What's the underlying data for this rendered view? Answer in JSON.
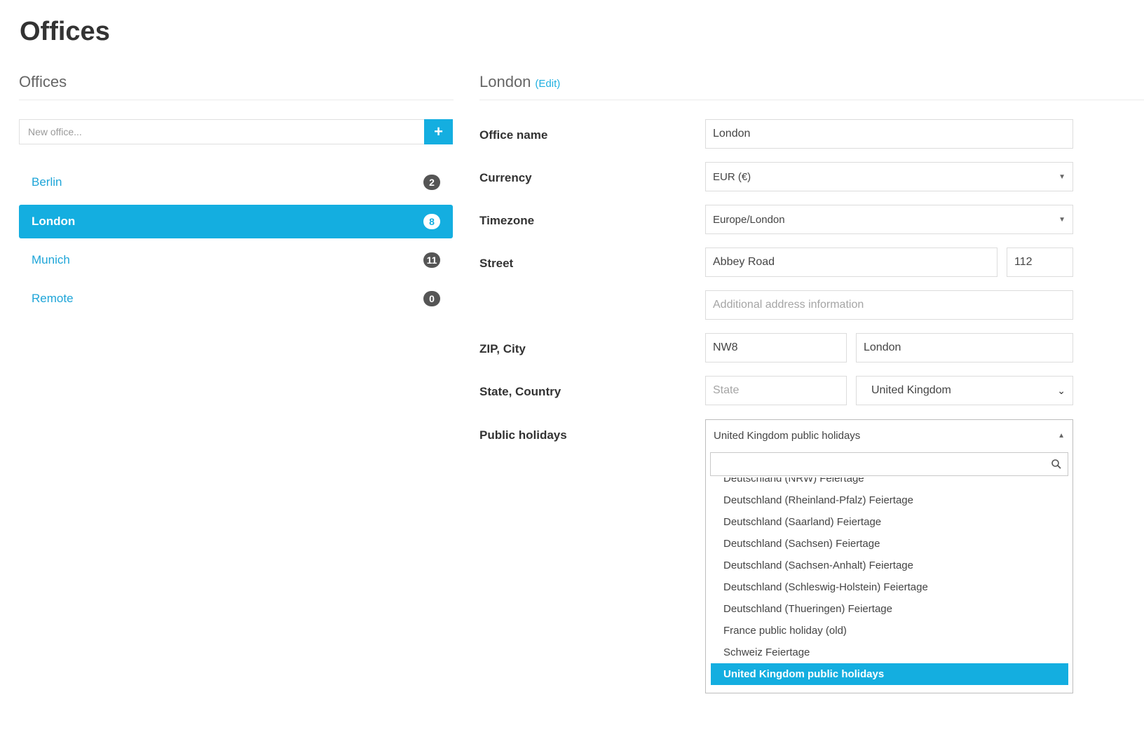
{
  "page": {
    "title": "Offices"
  },
  "left": {
    "section_title": "Offices",
    "new_office_placeholder": "New office...",
    "add_label": "+",
    "offices": [
      {
        "name": "Berlin",
        "count": "2"
      },
      {
        "name": "London",
        "count": "8"
      },
      {
        "name": "Munich",
        "count": "11"
      },
      {
        "name": "Remote",
        "count": "0"
      }
    ]
  },
  "right": {
    "section_title": "London",
    "edit_label": "(Edit)",
    "labels": {
      "office_name": "Office name",
      "currency": "Currency",
      "timezone": "Timezone",
      "street": "Street",
      "zip_city": "ZIP, City",
      "state_country": "State, Country",
      "public_holidays": "Public holidays"
    },
    "values": {
      "office_name": "London",
      "currency": "EUR (€)",
      "timezone": "Europe/London",
      "street": "Abbey Road",
      "street_number": "112",
      "additional_placeholder": "Additional address information",
      "zip": "NW8",
      "city": "London",
      "state_placeholder": "State",
      "country": "United Kingdom",
      "public_holidays": "United Kingdom public holidays"
    },
    "holidays_options": [
      "Deutschland (NRW) Feiertage",
      "Deutschland (Rheinland-Pfalz) Feiertage",
      "Deutschland (Saarland) Feiertage",
      "Deutschland (Sachsen) Feiertage",
      "Deutschland (Sachsen-Anhalt) Feiertage",
      "Deutschland (Schleswig-Holstein) Feiertage",
      "Deutschland (Thueringen) Feiertage",
      "France public holiday (old)",
      "Schweiz Feiertage",
      "United Kingdom public holidays"
    ],
    "selected_holiday_index": 9
  },
  "colors": {
    "accent": "#14aee0",
    "link": "#1ea5d8",
    "badge": "#555555"
  },
  "icons": {
    "select_caret": "caret-down-icon",
    "dropdown_open": "caret-up-icon",
    "country_chevron": "chevron-down-icon",
    "search": "search-icon"
  }
}
